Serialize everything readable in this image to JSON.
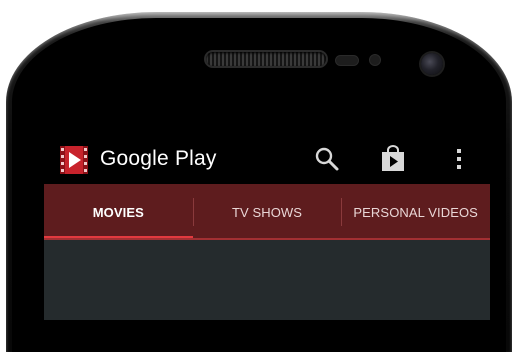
{
  "app": {
    "title": "Google Play"
  },
  "actionbar": {
    "icons": [
      "search-icon",
      "play-store-bag-icon",
      "overflow-menu-icon"
    ]
  },
  "tabs": [
    {
      "label": "MOVIES",
      "active": true
    },
    {
      "label": "TV SHOWS",
      "active": false
    },
    {
      "label": "PERSONAL VIDEOS",
      "active": false
    }
  ],
  "colors": {
    "tab_bar": "#5e1c1e",
    "tab_indicator": "#e23a3f",
    "content_bg": "#252b2d",
    "action_bar": "#000000"
  }
}
